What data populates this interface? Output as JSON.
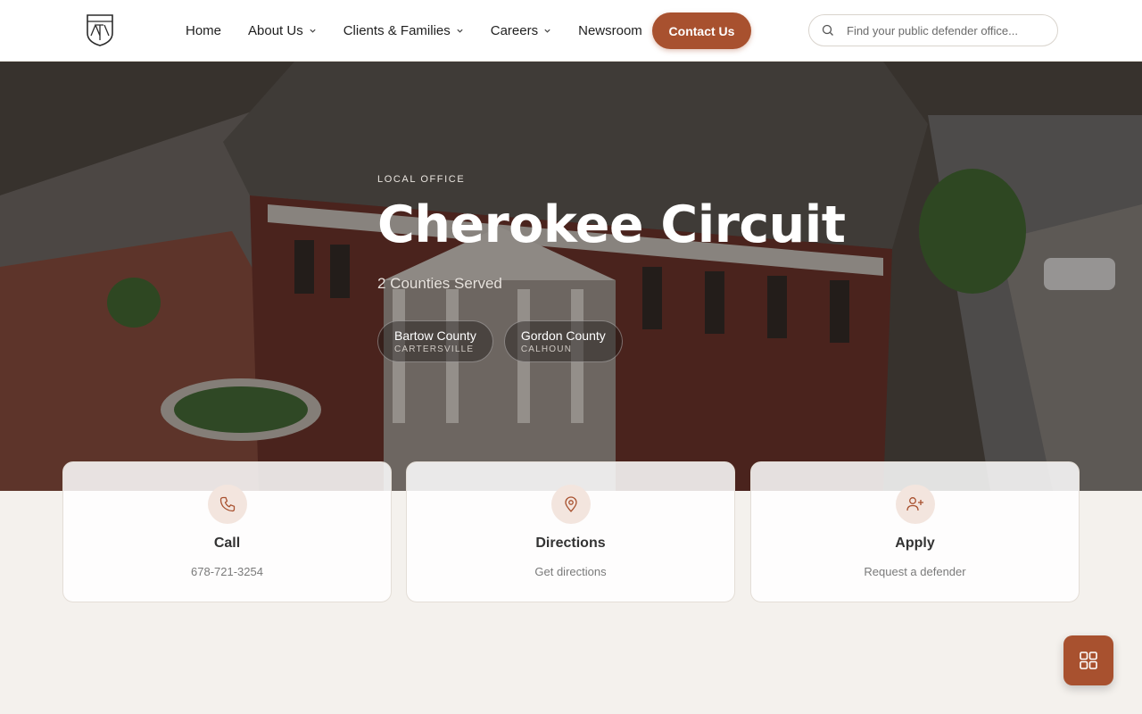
{
  "header": {
    "nav": [
      {
        "label": "Home",
        "has_dropdown": false
      },
      {
        "label": "About Us",
        "has_dropdown": true
      },
      {
        "label": "Clients & Families",
        "has_dropdown": true
      },
      {
        "label": "Careers",
        "has_dropdown": true
      },
      {
        "label": "Newsroom",
        "has_dropdown": false
      }
    ],
    "contact_label": "Contact Us",
    "search_placeholder": "Find your public defender office...",
    "icons": {
      "logo": "shield-logo-icon",
      "search": "search-icon",
      "dropdown": "chevron-down-icon"
    }
  },
  "hero": {
    "eyebrow": "LOCAL OFFICE",
    "title": "Cherokee Circuit",
    "subtitle": "2 Counties Served",
    "counties": [
      {
        "name": "Bartow County",
        "city": "CARTERSVILLE"
      },
      {
        "name": "Gordon County",
        "city": "CALHOUN"
      }
    ]
  },
  "cards": [
    {
      "icon": "phone-icon",
      "title": "Call",
      "subtitle": "678-721-3254"
    },
    {
      "icon": "map-pin-icon",
      "title": "Directions",
      "subtitle": "Get directions"
    },
    {
      "icon": "user-plus-icon",
      "title": "Apply",
      "subtitle": "Request a defender"
    }
  ],
  "fab": {
    "icon": "grid-icon"
  },
  "colors": {
    "accent": "#a8512f",
    "page_bg": "#f4f1ed",
    "icon_bg": "#f3e5de"
  }
}
